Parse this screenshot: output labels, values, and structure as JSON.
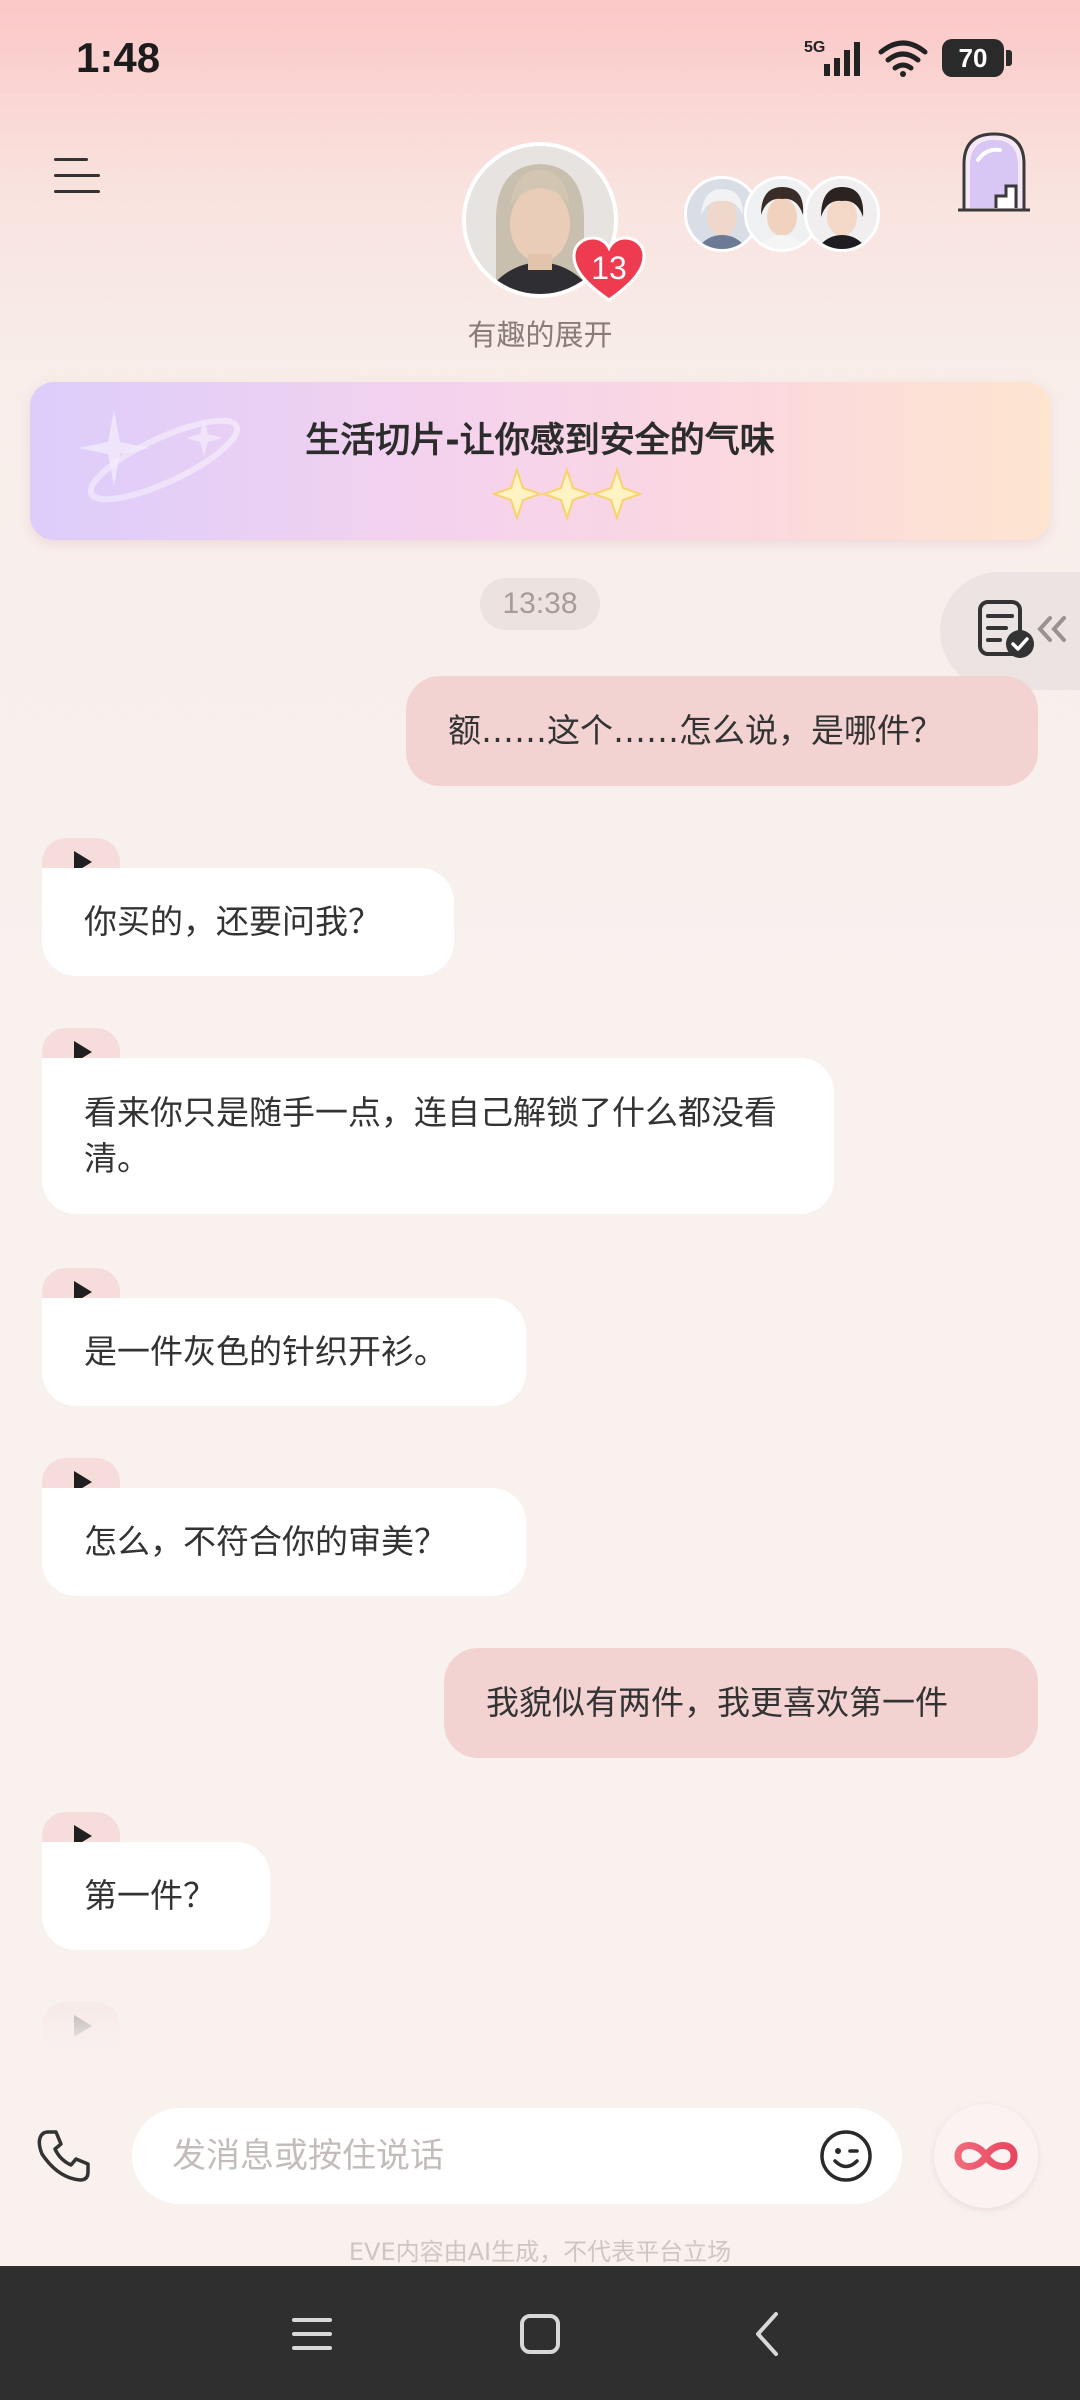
{
  "status_bar": {
    "time": "1:48",
    "network": "5G",
    "battery": "70"
  },
  "header": {
    "subtitle": "有趣的展开",
    "affection_count": "13"
  },
  "banner": {
    "title": "生活切片-让你感到安全的气味"
  },
  "chat": {
    "timestamp": "13:38",
    "messages": [
      {
        "role": "me",
        "text": "额……这个……怎么说，是哪件？"
      },
      {
        "role": "ai",
        "text": "你买的，还要问我？"
      },
      {
        "role": "ai",
        "text": "看来你只是随手一点，连自己解锁了什么都没看清。"
      },
      {
        "role": "ai",
        "text": "是一件灰色的针织开衫。"
      },
      {
        "role": "ai",
        "text": "怎么，不符合你的审美？"
      },
      {
        "role": "me",
        "text": "我貌似有两件，我更喜欢第一件"
      },
      {
        "role": "ai",
        "text": "第一件？"
      }
    ]
  },
  "input_bar": {
    "placeholder": "发消息或按住说话"
  },
  "disclaimer": "EVE内容由AI生成，不代表平台立场",
  "colors": {
    "me_bubble": "#f2d3d2",
    "ai_bubble": "#ffffff",
    "heart": "#ee3b4f",
    "nav_bar": "#2f2f2f"
  }
}
